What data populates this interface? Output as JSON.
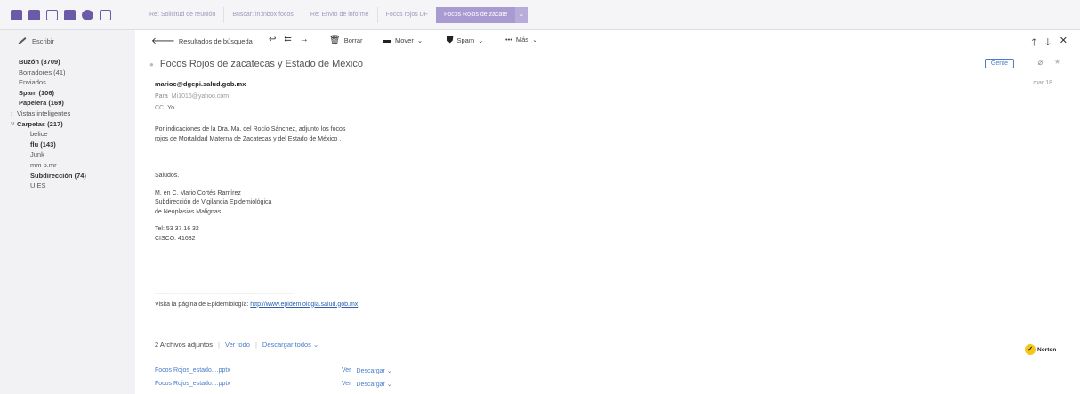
{
  "tabs": [
    {
      "label": "Re: Solicitud de reunión"
    },
    {
      "label": "Buscar: in:inbox focos"
    },
    {
      "label": "Re: Envío de informe"
    },
    {
      "label": "Focos rojos DF"
    },
    {
      "label": "Focos Rojos de zacate"
    }
  ],
  "app_icons": [
    "mail-icon",
    "contacts-icon",
    "calendar-icon",
    "notepad-icon",
    "messenger-icon",
    "newsfeed-icon"
  ],
  "sidebar": {
    "compose": "Escribir",
    "folders": [
      {
        "label": "Buzón (3709)",
        "bold": true
      },
      {
        "label": "Borradores (41)"
      },
      {
        "label": "Enviados"
      },
      {
        "label": "Spam (106)",
        "bold": true
      },
      {
        "label": "Papelera (169)",
        "bold": true
      },
      {
        "label": "Vistas inteligentes",
        "caret": "›"
      },
      {
        "label": "Carpetas (217)",
        "bold": true,
        "caret": "˅"
      },
      {
        "label": "belice"
      },
      {
        "label": "flu (143)",
        "bold": true
      },
      {
        "label": "Junk"
      },
      {
        "label": "mm p.mr"
      },
      {
        "label": "Subdirección (74)",
        "bold": true
      },
      {
        "label": "UIES"
      }
    ]
  },
  "toolbar": {
    "back": "Resultados de búsqueda",
    "delete": "Borrar",
    "move": "Mover",
    "spam": "Spam",
    "more": "Más"
  },
  "message": {
    "subject": "Focos Rojos de zacatecas y Estado de México",
    "people_button": "Gente",
    "from": "marioc@dgepi.salud.gob.mx",
    "date": "mar 18",
    "to_label": "Para",
    "to": "Mi1016@yahoo.com",
    "cc_label": "CC",
    "cc": "Yo",
    "body_lines": [
      "Por indicaciones de la Dra. Ma. del Rocío Sánchez, adjunto los focos",
      "rojos de Mortalidad Materna de  Zacatecas y del Estado de México ."
    ],
    "greeting": "Saludos.",
    "signature": [
      "M. en C. Mario Cortés Ramírez",
      "Subdirección de Vigilancia Epidemiológica",
      "de Neoplasias Malignas"
    ],
    "contact": [
      "Tel:  53 37 16 32",
      "CISCO: 41632"
    ],
    "separator": "-------------------------------------------------------------------",
    "visit_text": "Visita la página de Epidemiología: ",
    "visit_link": "http://www.epidemiologia.salud.gob.mx"
  },
  "attachments": {
    "count_label": "2 Archivos adjuntos",
    "view_all": "Ver todo",
    "download_all": "Descargar todos",
    "files": [
      {
        "name": "Focos Rojos_estado....pptx",
        "view": "Ver",
        "download": "Descargar"
      },
      {
        "name": "Focos Rojos_estado....pptx",
        "view": "Ver",
        "download": "Descargar"
      }
    ]
  },
  "norton": "Norton"
}
